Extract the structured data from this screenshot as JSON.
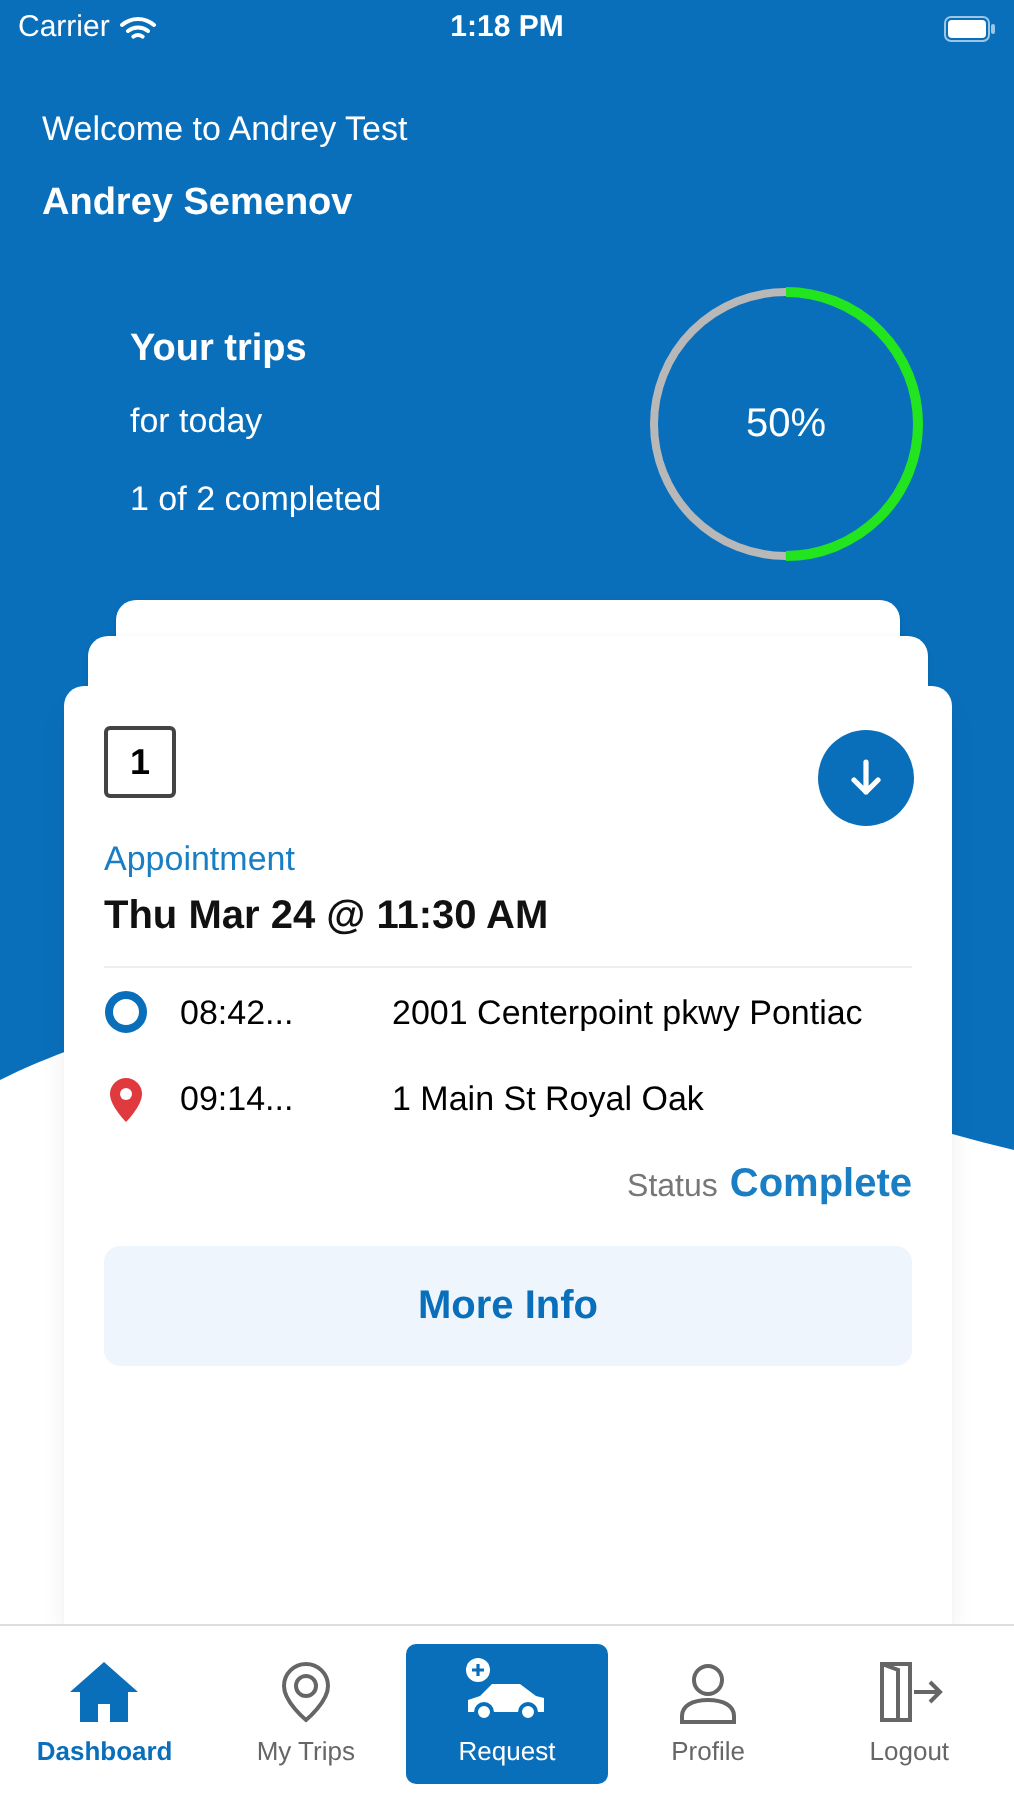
{
  "status_bar": {
    "carrier": "Carrier",
    "time": "1:18 PM"
  },
  "header": {
    "welcome": "Welcome to Andrey Test",
    "user_name": "Andrey Semenov"
  },
  "trips_summary": {
    "title": "Your trips",
    "subtitle": "for today",
    "completed": "1 of 2 completed",
    "level": 0.5,
    "reading": "50%"
  },
  "trip_card": {
    "number": "1",
    "label": "Appointment",
    "datetime": "Thu Mar 24 @ 11:30 AM",
    "stops": [
      {
        "kind": "pickup",
        "time": "08:42...",
        "address": "2001 Centerpoint pkwy Pontiac"
      },
      {
        "kind": "dropoff",
        "time": "09:14...",
        "address": "1 Main St Royal Oak"
      }
    ],
    "status_label": "Status",
    "status": "Complete",
    "button": "More Info"
  },
  "tab_bar": [
    {
      "kind": "home",
      "label": "Dashboard",
      "selected": true
    },
    {
      "kind": "trips",
      "label": "My Trips",
      "selected": false
    },
    {
      "kind": "request",
      "label": "Request",
      "selected": false
    },
    {
      "kind": "profile",
      "label": "Profile",
      "selected": false
    },
    {
      "kind": "logout",
      "label": "Logout",
      "selected": false
    }
  ]
}
